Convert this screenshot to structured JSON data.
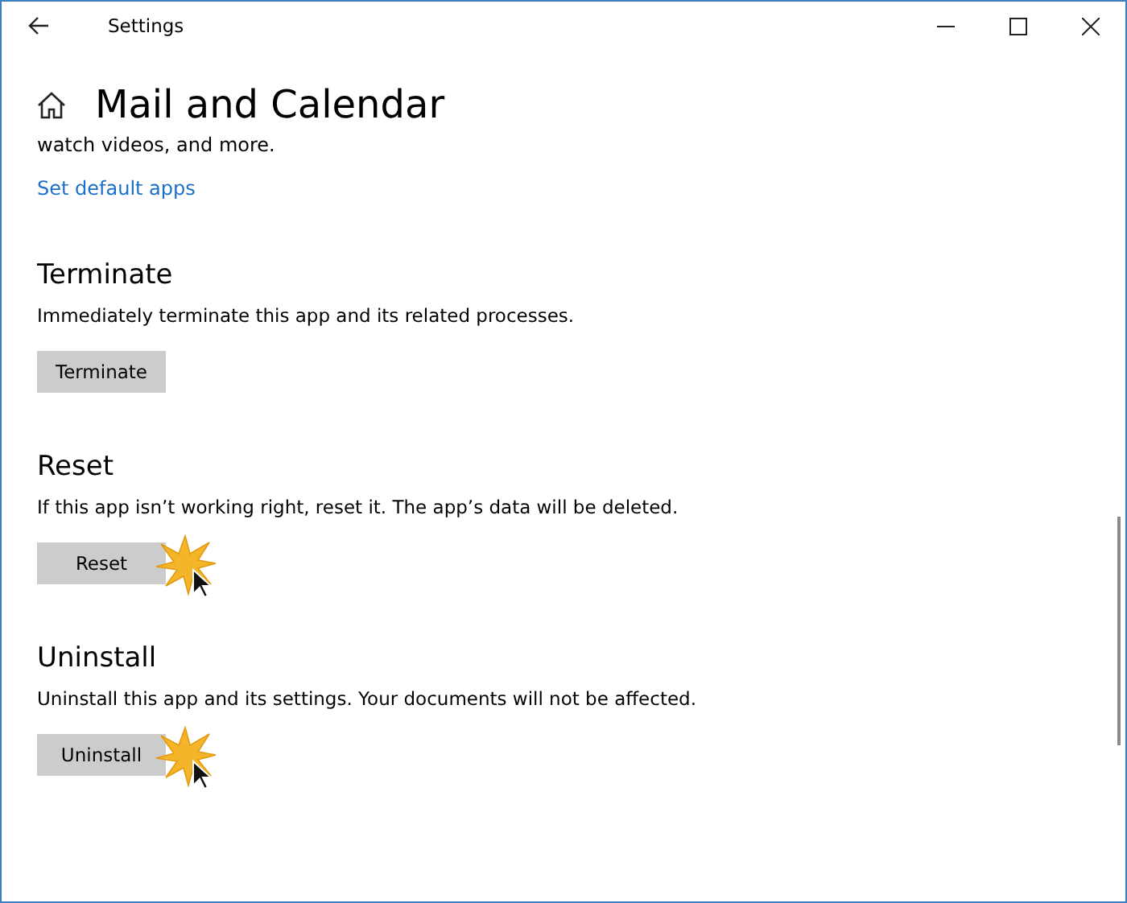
{
  "window": {
    "title": "Settings"
  },
  "page": {
    "title": "Mail and Calendar",
    "intro_tail": "watch videos, and more.",
    "link": "Set default apps"
  },
  "sections": [
    {
      "title": "Terminate",
      "description": "Immediately terminate this app and its related processes.",
      "button": "Terminate",
      "click_highlighted": false
    },
    {
      "title": "Reset",
      "description": "If this app isn’t working right, reset it. The app’s data will be deleted.",
      "button": "Reset",
      "click_highlighted": true
    },
    {
      "title": "Uninstall",
      "description": "Uninstall this app and its settings. Your documents will not be affected.",
      "button": "Uninstall",
      "click_highlighted": true
    }
  ]
}
